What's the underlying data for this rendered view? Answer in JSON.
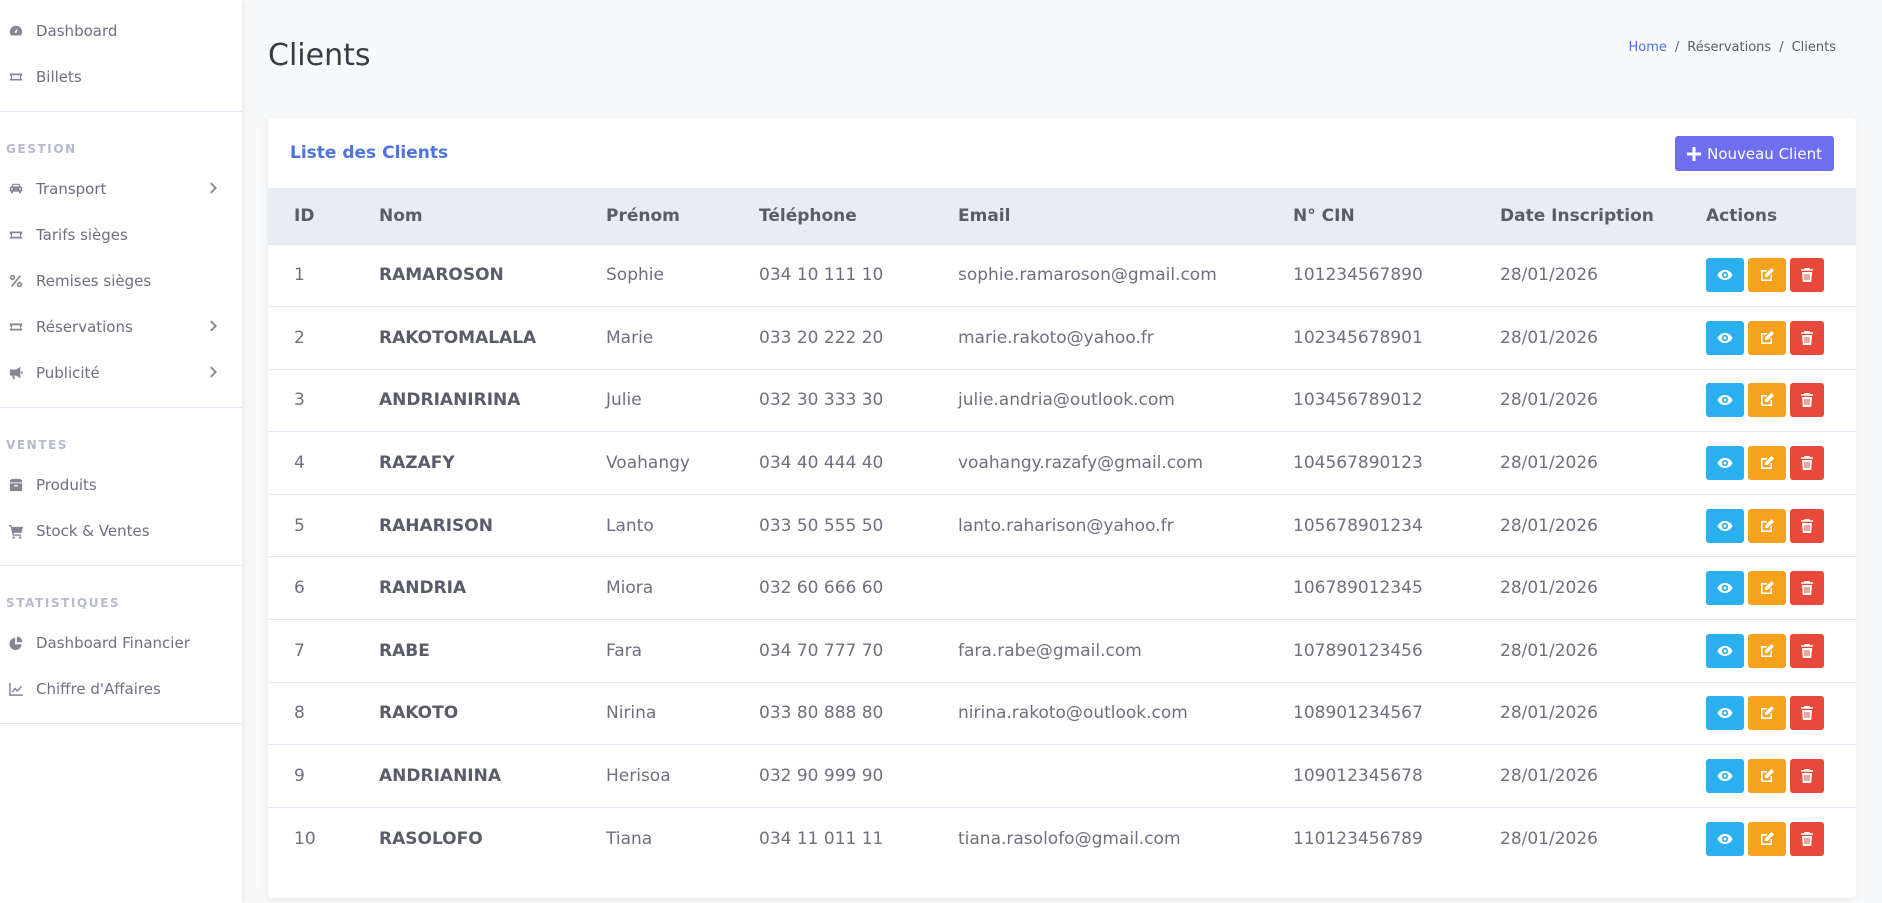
{
  "sidebar": {
    "top_items": [
      {
        "label": "Dashboard",
        "icon": "gauge-icon"
      },
      {
        "label": "Billets",
        "icon": "ticket-icon"
      }
    ],
    "sections": [
      {
        "title": "GESTION",
        "items": [
          {
            "label": "Transport",
            "icon": "car-icon",
            "has_children": true
          },
          {
            "label": "Tarifs sièges",
            "icon": "ticket-icon",
            "has_children": false
          },
          {
            "label": "Remises sièges",
            "icon": "percent-icon",
            "has_children": false
          },
          {
            "label": "Réservations",
            "icon": "ticket-icon",
            "has_children": true
          },
          {
            "label": "Publicité",
            "icon": "megaphone-icon",
            "has_children": true
          }
        ]
      },
      {
        "title": "VENTES",
        "items": [
          {
            "label": "Produits",
            "icon": "box-icon",
            "has_children": false
          },
          {
            "label": "Stock & Ventes",
            "icon": "cart-icon",
            "has_children": false
          }
        ]
      },
      {
        "title": "STATISTIQUES",
        "items": [
          {
            "label": "Dashboard Financier",
            "icon": "pie-chart-icon",
            "has_children": false
          },
          {
            "label": "Chiffre d'Affaires",
            "icon": "line-chart-icon",
            "has_children": false
          }
        ]
      }
    ]
  },
  "header": {
    "title": "Clients",
    "breadcrumb": [
      "Home",
      "Réservations",
      "Clients"
    ]
  },
  "card": {
    "title": "Liste des Clients",
    "new_button_label": "Nouveau Client"
  },
  "table": {
    "columns": [
      "ID",
      "Nom",
      "Prénom",
      "Téléphone",
      "Email",
      "N° CIN",
      "Date Inscription",
      "Actions"
    ],
    "rows": [
      {
        "id": "1",
        "nom": "RAMAROSON",
        "prenom": "Sophie",
        "tel": "034 10 111 10",
        "email": "sophie.ramaroson@gmail.com",
        "cin": "101234567890",
        "date": "28/01/2026"
      },
      {
        "id": "2",
        "nom": "RAKOTOMALALA",
        "prenom": "Marie",
        "tel": "033 20 222 20",
        "email": "marie.rakoto@yahoo.fr",
        "cin": "102345678901",
        "date": "28/01/2026"
      },
      {
        "id": "3",
        "nom": "ANDRIANIRINA",
        "prenom": "Julie",
        "tel": "032 30 333 30",
        "email": "julie.andria@outlook.com",
        "cin": "103456789012",
        "date": "28/01/2026"
      },
      {
        "id": "4",
        "nom": "RAZAFY",
        "prenom": "Voahangy",
        "tel": "034 40 444 40",
        "email": "voahangy.razafy@gmail.com",
        "cin": "104567890123",
        "date": "28/01/2026"
      },
      {
        "id": "5",
        "nom": "RAHARISON",
        "prenom": "Lanto",
        "tel": "033 50 555 50",
        "email": "lanto.raharison@yahoo.fr",
        "cin": "105678901234",
        "date": "28/01/2026"
      },
      {
        "id": "6",
        "nom": "RANDRIA",
        "prenom": "Miora",
        "tel": "032 60 666 60",
        "email": "",
        "cin": "106789012345",
        "date": "28/01/2026"
      },
      {
        "id": "7",
        "nom": "RABE",
        "prenom": "Fara",
        "tel": "034 70 777 70",
        "email": "fara.rabe@gmail.com",
        "cin": "107890123456",
        "date": "28/01/2026"
      },
      {
        "id": "8",
        "nom": "RAKOTO",
        "prenom": "Nirina",
        "tel": "033 80 888 80",
        "email": "nirina.rakoto@outlook.com",
        "cin": "108901234567",
        "date": "28/01/2026"
      },
      {
        "id": "9",
        "nom": "ANDRIANINA",
        "prenom": "Herisoa",
        "tel": "032 90 999 90",
        "email": "",
        "cin": "109012345678",
        "date": "28/01/2026"
      },
      {
        "id": "10",
        "nom": "RASOLOFO",
        "prenom": "Tiana",
        "tel": "034 11 011 11",
        "email": "tiana.rasolofo@gmail.com",
        "cin": "110123456789",
        "date": "28/01/2026"
      }
    ],
    "row_actions": [
      "eye-icon",
      "edit-icon",
      "trash-icon"
    ]
  },
  "colors": {
    "primary": "#4e73df",
    "new_button": "#6f6ef0",
    "view_button": "#2bb0ef",
    "edit_button": "#f6a21e",
    "delete_button": "#e74a3b"
  }
}
